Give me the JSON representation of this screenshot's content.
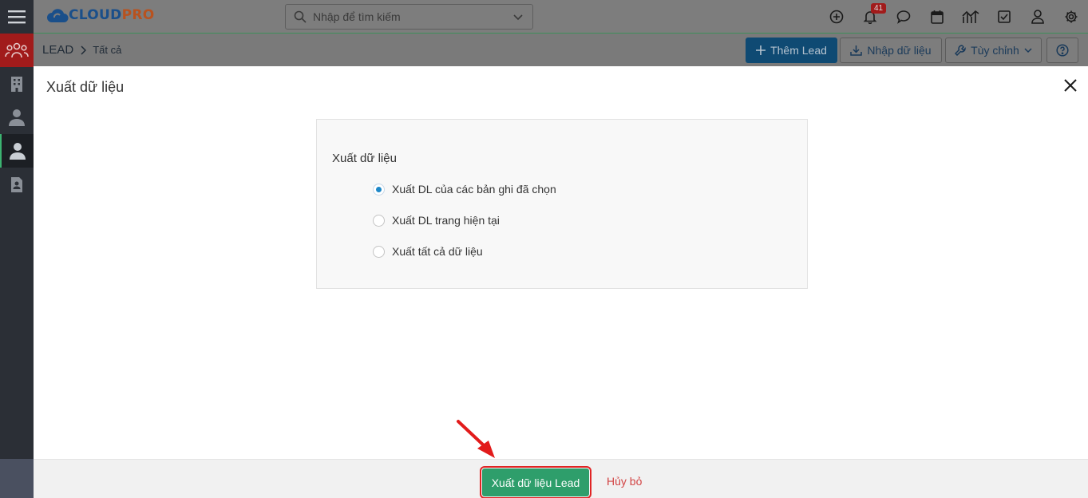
{
  "app": {
    "logo_main": "CLOUD",
    "logo_accent": "PRO"
  },
  "search": {
    "placeholder": "Nhập để tìm kiếm"
  },
  "notifications": {
    "count": "41"
  },
  "breadcrumb": {
    "module": "LEAD",
    "view": "Tất cả"
  },
  "toolbar": {
    "add_label": "Thêm Lead",
    "import_label": "Nhập dữ liệu",
    "customize_label": "Tùy chỉnh"
  },
  "modal": {
    "title": "Xuất dữ liệu",
    "section_title": "Xuất dữ liệu",
    "options": [
      {
        "label": "Xuất DL của các bản ghi đã chọn",
        "checked": true
      },
      {
        "label": "Xuất DL trang hiện tại",
        "checked": false
      },
      {
        "label": "Xuất tất cả dữ liệu",
        "checked": false
      }
    ],
    "export_label": "Xuất dữ liệu Lead",
    "cancel_label": "Hủy bỏ"
  },
  "colors": {
    "primary": "#0f4a73",
    "export_button": "#2e9e6b",
    "highlight": "#e02424",
    "radio_selected": "#1e88c8",
    "cancel_text": "#d24444"
  },
  "icons": [
    "menu-icon",
    "users-group-icon",
    "building-icon",
    "contact-icon",
    "person-icon",
    "document-icon",
    "search-icon",
    "chevron-down-icon",
    "plus-circle-icon",
    "bell-icon",
    "chat-icon",
    "calendar-icon",
    "chart-icon",
    "task-icon",
    "user-icon",
    "gear-icon",
    "plus-icon",
    "download-icon",
    "wrench-icon",
    "help-icon",
    "close-icon",
    "arrow-icon"
  ]
}
